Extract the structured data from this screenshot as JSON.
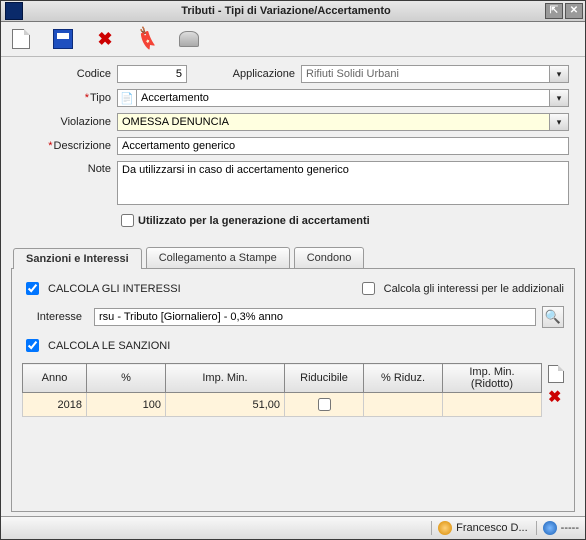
{
  "window": {
    "title": "Tributi - Tipi di Variazione/Accertamento"
  },
  "toolbar": {
    "new": "new",
    "save": "save",
    "delete": "delete",
    "attach": "attach",
    "other": "other"
  },
  "labels": {
    "codice": "Codice",
    "applicazione": "Applicazione",
    "tipo": "Tipo",
    "violazione": "Violazione",
    "descrizione": "Descrizione",
    "note": "Note",
    "utilizzo": "Utilizzato per la generazione di accertamenti",
    "calc_interessi": "CALCOLA GLI INTERESSI",
    "calc_addizionali": "Calcola gli interessi per le addizionali",
    "interesse": "Interesse",
    "calc_sanzioni": "CALCOLA LE SANZIONI"
  },
  "values": {
    "codice": "5",
    "applicazione": "Rifiuti Solidi Urbani",
    "tipo": "Accertamento",
    "violazione": "OMESSA DENUNCIA",
    "descrizione": "Accertamento generico",
    "note": "Da utilizzarsi in caso di accertamento generico",
    "interesse": "rsu - Tributo [Giornaliero] - 0,3% anno"
  },
  "tabs": {
    "sanzioni": "Sanzioni e Interessi",
    "stampe": "Collegamento a Stampe",
    "condono": "Condono"
  },
  "table": {
    "headers": {
      "anno": "Anno",
      "perc": "%",
      "impmin": "Imp. Min.",
      "riducibile": "Riducibile",
      "percrid": "% Riduz.",
      "impminrid": "Imp. Min. (Ridotto)"
    },
    "row": {
      "anno": "2018",
      "perc": "100",
      "impmin": "51,00",
      "riducibile": "",
      "percrid": "",
      "impminrid": ""
    }
  },
  "status": {
    "user": "Francesco D...",
    "other": "-----"
  }
}
